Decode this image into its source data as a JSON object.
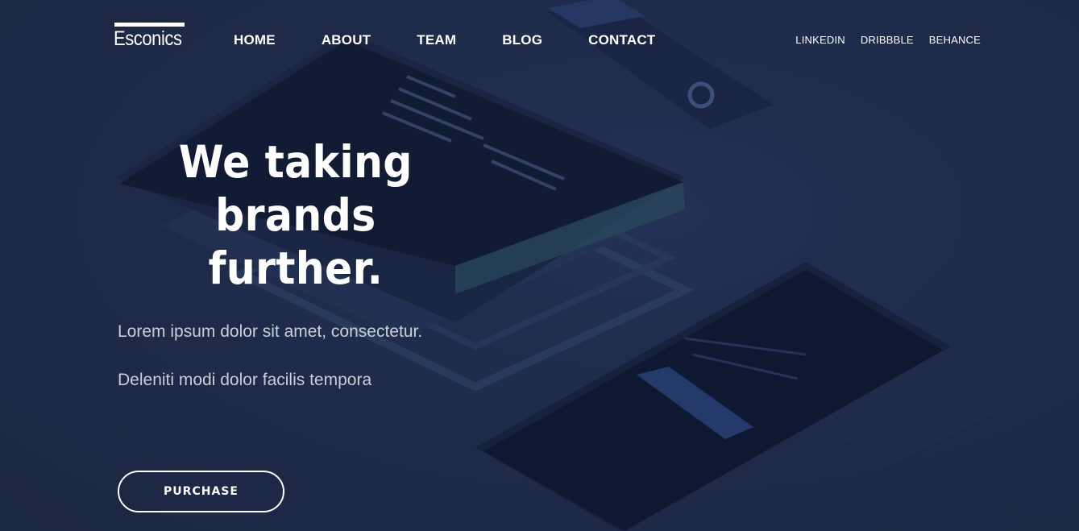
{
  "brand": {
    "logo_text": "Esconics"
  },
  "nav": {
    "items": [
      {
        "label": "HOME"
      },
      {
        "label": "ABOUT"
      },
      {
        "label": "TEAM"
      },
      {
        "label": "BLOG"
      },
      {
        "label": "CONTACT"
      }
    ]
  },
  "social": {
    "items": [
      {
        "label": "LINKEDIN"
      },
      {
        "label": "DRIBBBLE"
      },
      {
        "label": "BEHANCE"
      }
    ]
  },
  "hero": {
    "headline_line1": "We taking brands",
    "headline_line2": "further.",
    "subtext_line1": "Lorem ipsum dolor sit amet, consectetur.",
    "subtext_line2": "Deleniti modi dolor facilis tempora",
    "cta_label": "PURCHASE"
  },
  "colors": {
    "background": "#1e2a48",
    "text": "#ffffff",
    "subtext": "#c9ced8"
  }
}
